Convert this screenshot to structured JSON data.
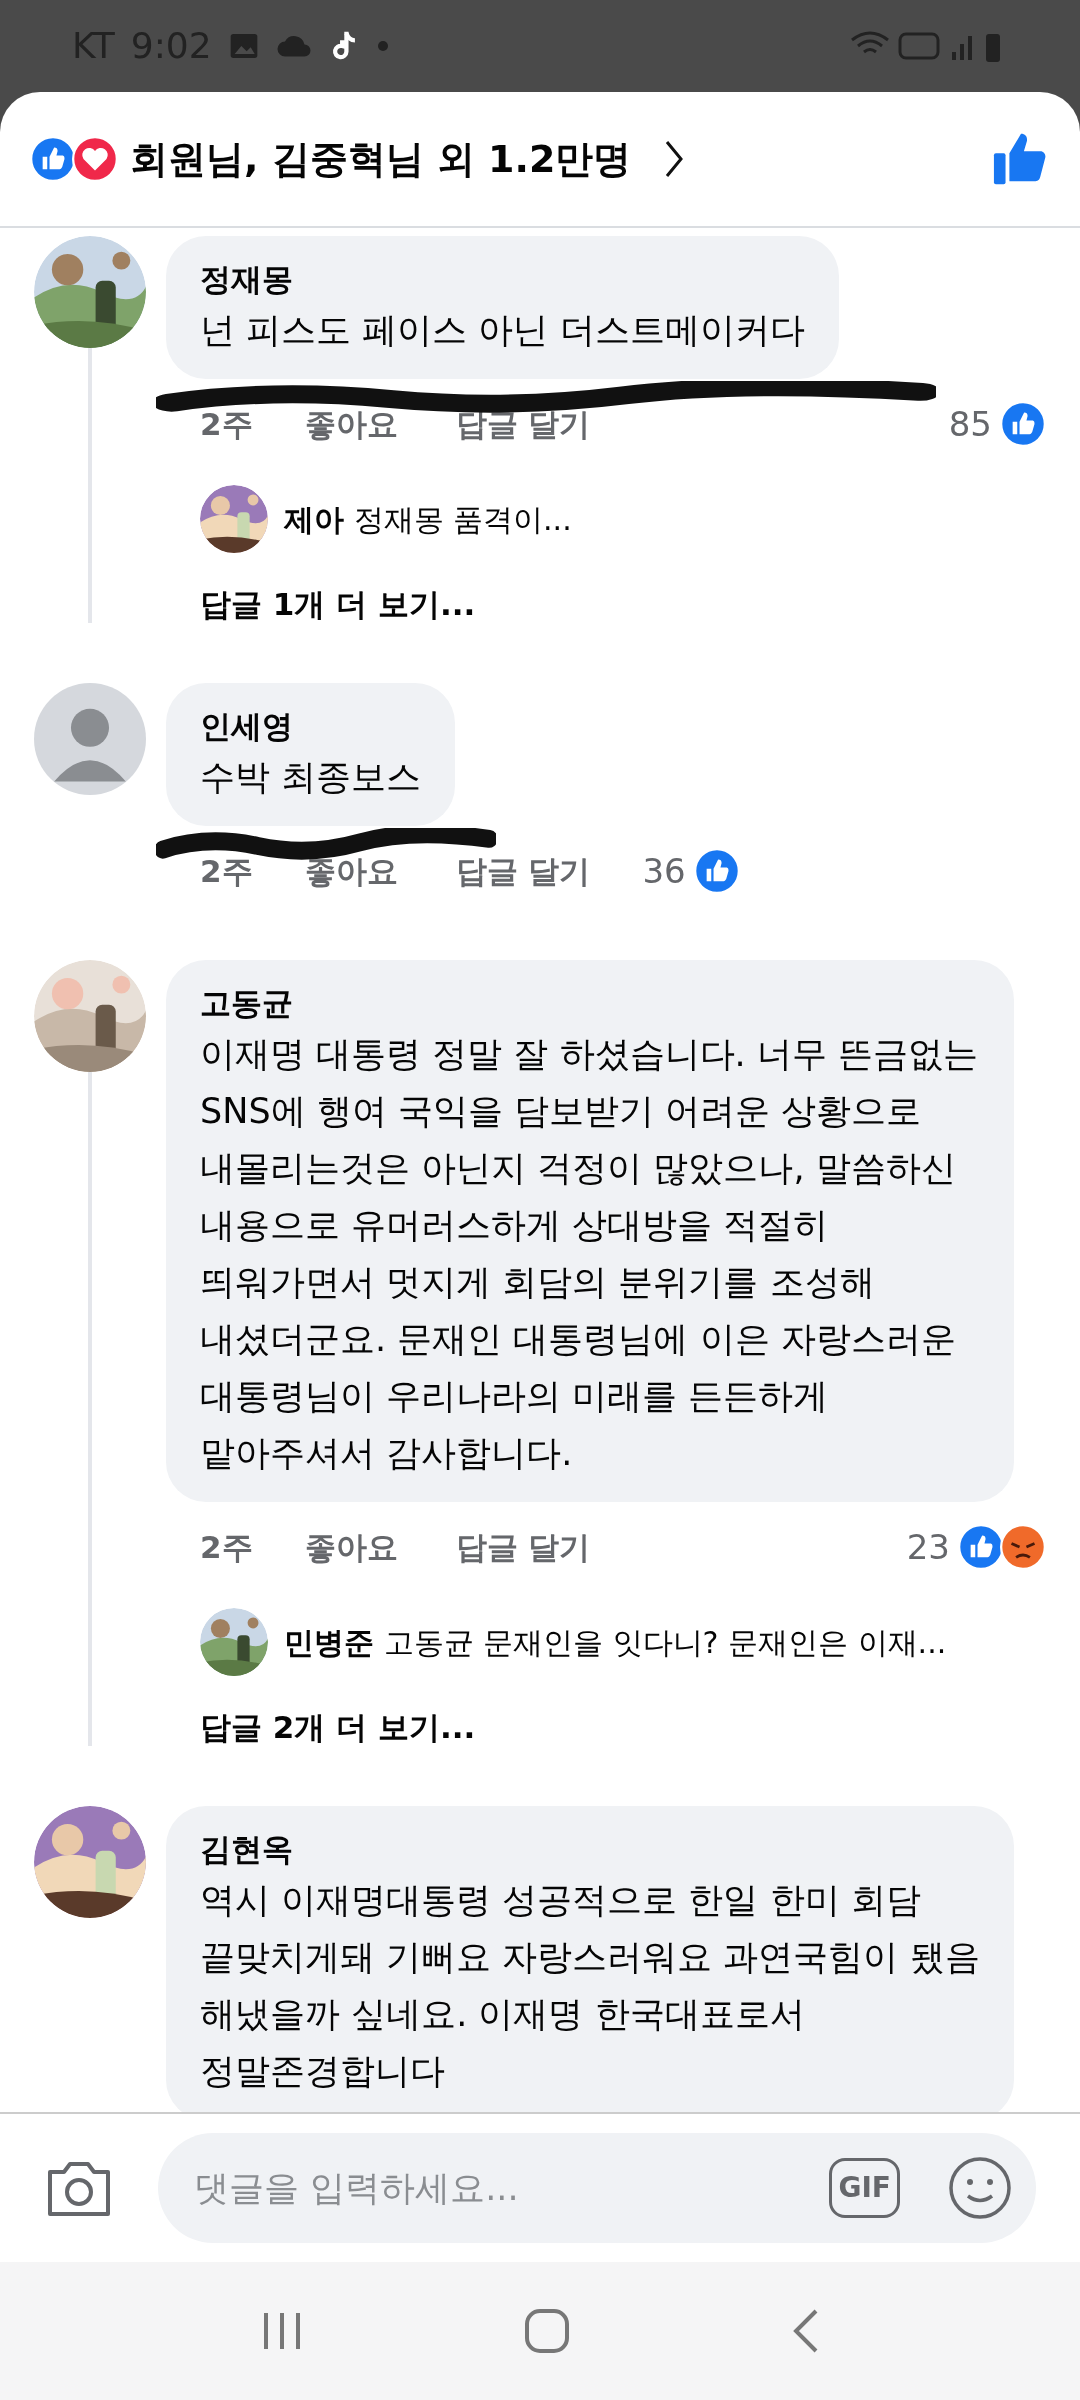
{
  "status_bar": {
    "carrier": "KT",
    "time": "9:02"
  },
  "header": {
    "title": "회원님, 김중혁님 외 1.2만명",
    "reactions": [
      {
        "kind": "like"
      },
      {
        "kind": "love"
      }
    ]
  },
  "comments": [
    {
      "name": "정재몽",
      "text": "넌 피스도 페이스 아닌 더스트메이커다",
      "avatar": {
        "kind": "picture"
      },
      "redacted": true,
      "time": "2주",
      "like": "좋아요",
      "reply": "답글 달기",
      "count": "85",
      "reactions": [
        {
          "kind": "like"
        }
      ],
      "replies": [
        {
          "name": "제아",
          "text": "정재몽 품격이..."
        }
      ],
      "more": "답글 1개 더 보기..."
    },
    {
      "name": "인세영",
      "text": "수박 최종보스",
      "avatar": {
        "kind": "silhouette"
      },
      "redacted": true,
      "time": "2주",
      "like": "좋아요",
      "reply": "답글 달기",
      "count": "36",
      "reactions": [
        {
          "kind": "like"
        }
      ]
    },
    {
      "name": "고동균",
      "text": "이재명 대통령 정말 잘 하셨습니다. 너무 뜬금없는 SNS에 행여 국익을 담보받기 어려운 상황으로 내몰리는것은 아닌지 걱정이 많았으나, 말씀하신 내용으로 유머러스하게 상대방을 적절히 띄워가면서 멋지게 회담의 분위기를 조성해 내셨더군요. 문재인 대통령님에 이은 자랑스러운 대통령님이 우리나라의 미래를 든든하게 맡아주셔서 감사합니다.",
      "avatar": {
        "kind": "picture"
      },
      "time": "2주",
      "like": "좋아요",
      "reply": "답글 달기",
      "count": "23",
      "reactions": [
        {
          "kind": "like"
        },
        {
          "kind": "angry"
        }
      ],
      "replies": [
        {
          "name": "민병준",
          "text": "고동균 문재인을 잇다니?  문재인은 이재..."
        }
      ],
      "more": "답글 2개 더 보기..."
    },
    {
      "name": "김현옥",
      "text": "역시 이재명대통령 성공적으로 한일 한미 회담 끝맞치게돼 기뻐요 자랑스러워요 과연국힘이 됐음 해냈을까 싶네요. 이재명 한국대표로서 정말존경합니다",
      "avatar": {
        "kind": "picture"
      }
    }
  ],
  "composer": {
    "placeholder": "댓글을 입력하세요...",
    "gif": "GIF"
  }
}
